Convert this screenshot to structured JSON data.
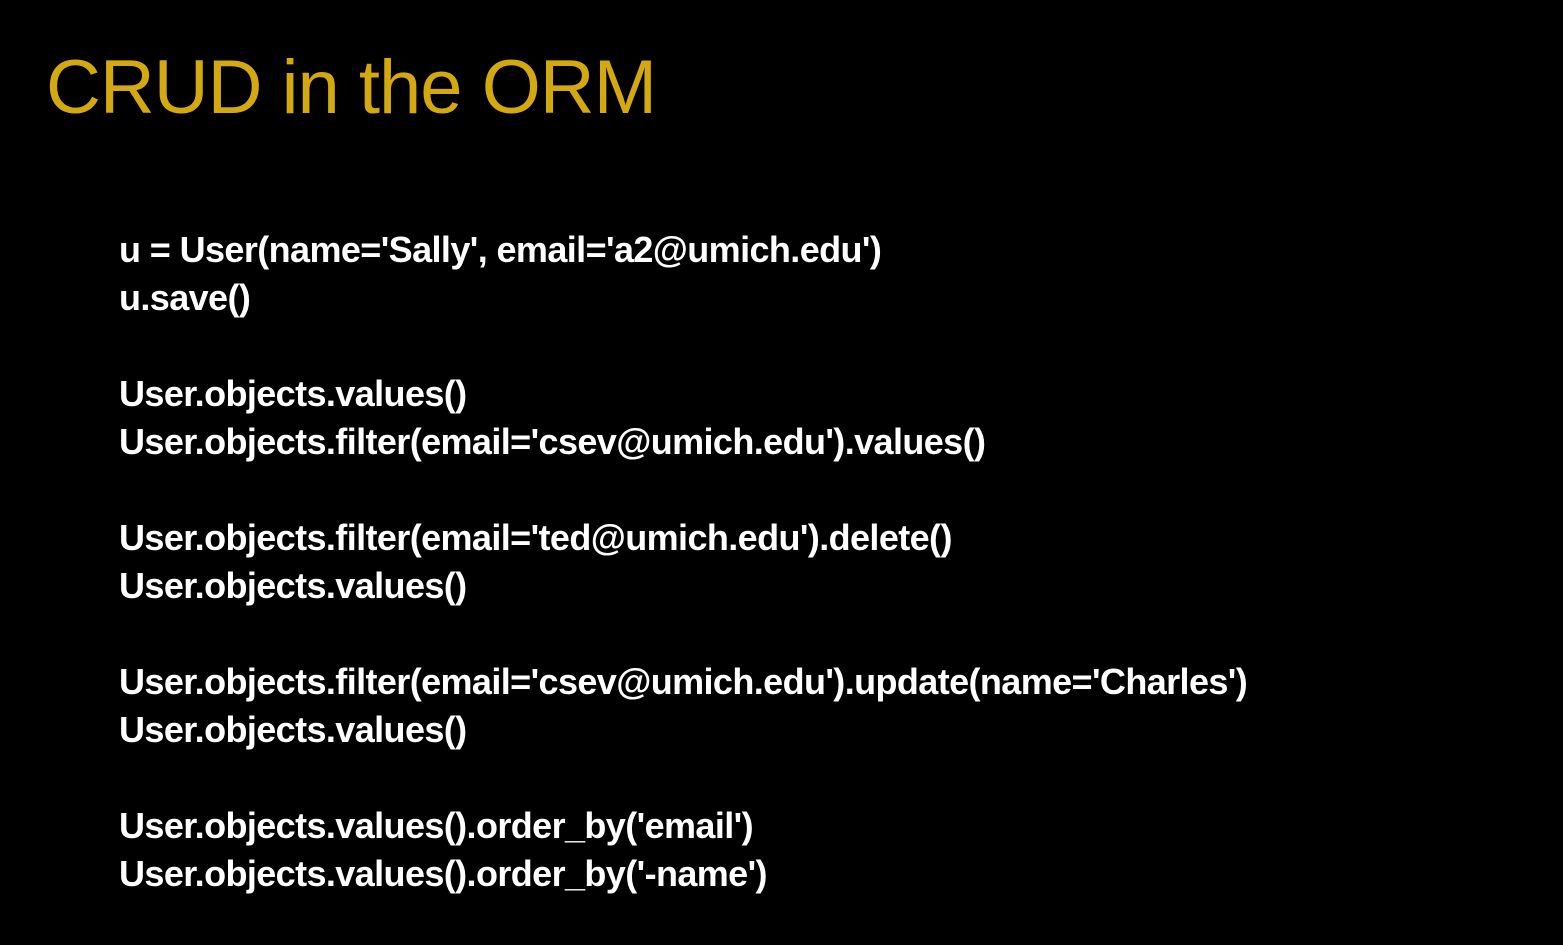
{
  "slide": {
    "title": "CRUD in the ORM",
    "title_color": "#D4A80F",
    "code_lines": [
      "u = User(name='Sally', email='a2@umich.edu')",
      "u.save()",
      "",
      "User.objects.values()",
      "User.objects.filter(email='csev@umich.edu').values()",
      "",
      "User.objects.filter(email='ted@umich.edu').delete()",
      "User.objects.values()",
      "",
      "User.objects.filter(email='csev@umich.edu').update(name='Charles')",
      "User.objects.values()",
      "",
      "User.objects.values().order_by('email')",
      "User.objects.values().order_by('-name')"
    ]
  }
}
